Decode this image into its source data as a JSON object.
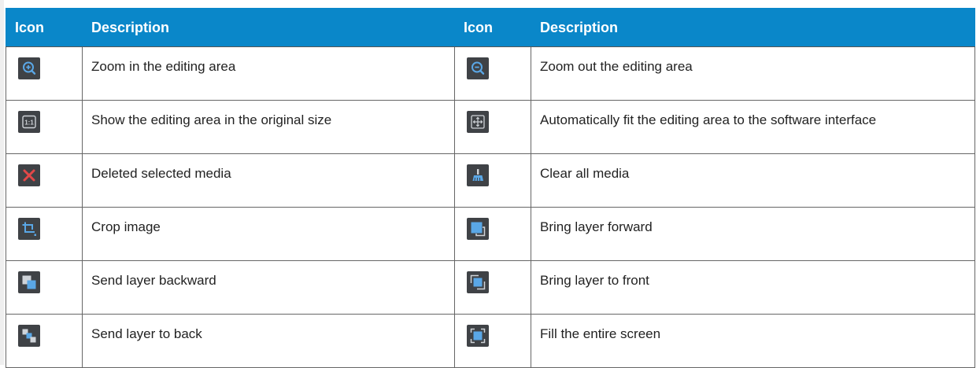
{
  "header": {
    "icon_label_left": "Icon",
    "description_label_left": "Description",
    "icon_label_right": "Icon",
    "description_label_right": "Description"
  },
  "rows": [
    {
      "left_icon": "zoom-in-icon",
      "left_text": "Zoom in the editing area",
      "right_icon": "zoom-out-icon",
      "right_text": "Zoom out the editing area"
    },
    {
      "left_icon": "original-size-icon",
      "left_text": "Show the editing area in the original size",
      "right_icon": "fit-to-screen-icon",
      "right_text": "Automatically fit the editing area to the software interface"
    },
    {
      "left_icon": "delete-icon",
      "left_text": "Deleted selected media",
      "right_icon": "clear-all-brush-icon",
      "right_text": "Clear all media"
    },
    {
      "left_icon": "crop-icon",
      "left_text": "Crop image",
      "right_icon": "bring-forward-icon",
      "right_text": "Bring layer forward"
    },
    {
      "left_icon": "send-backward-icon",
      "left_text": "Send layer backward",
      "right_icon": "bring-to-front-icon",
      "right_text": "Bring layer to front"
    },
    {
      "left_icon": "send-to-back-icon",
      "left_text": "Send layer to back",
      "right_icon": "fill-screen-icon",
      "right_text": "Fill the entire screen"
    }
  ],
  "colors": {
    "header_bg": "#0a87c9",
    "icon_bg": "#3f4246",
    "icon_accent": "#5aa7e6",
    "delete_red": "#e34848"
  }
}
